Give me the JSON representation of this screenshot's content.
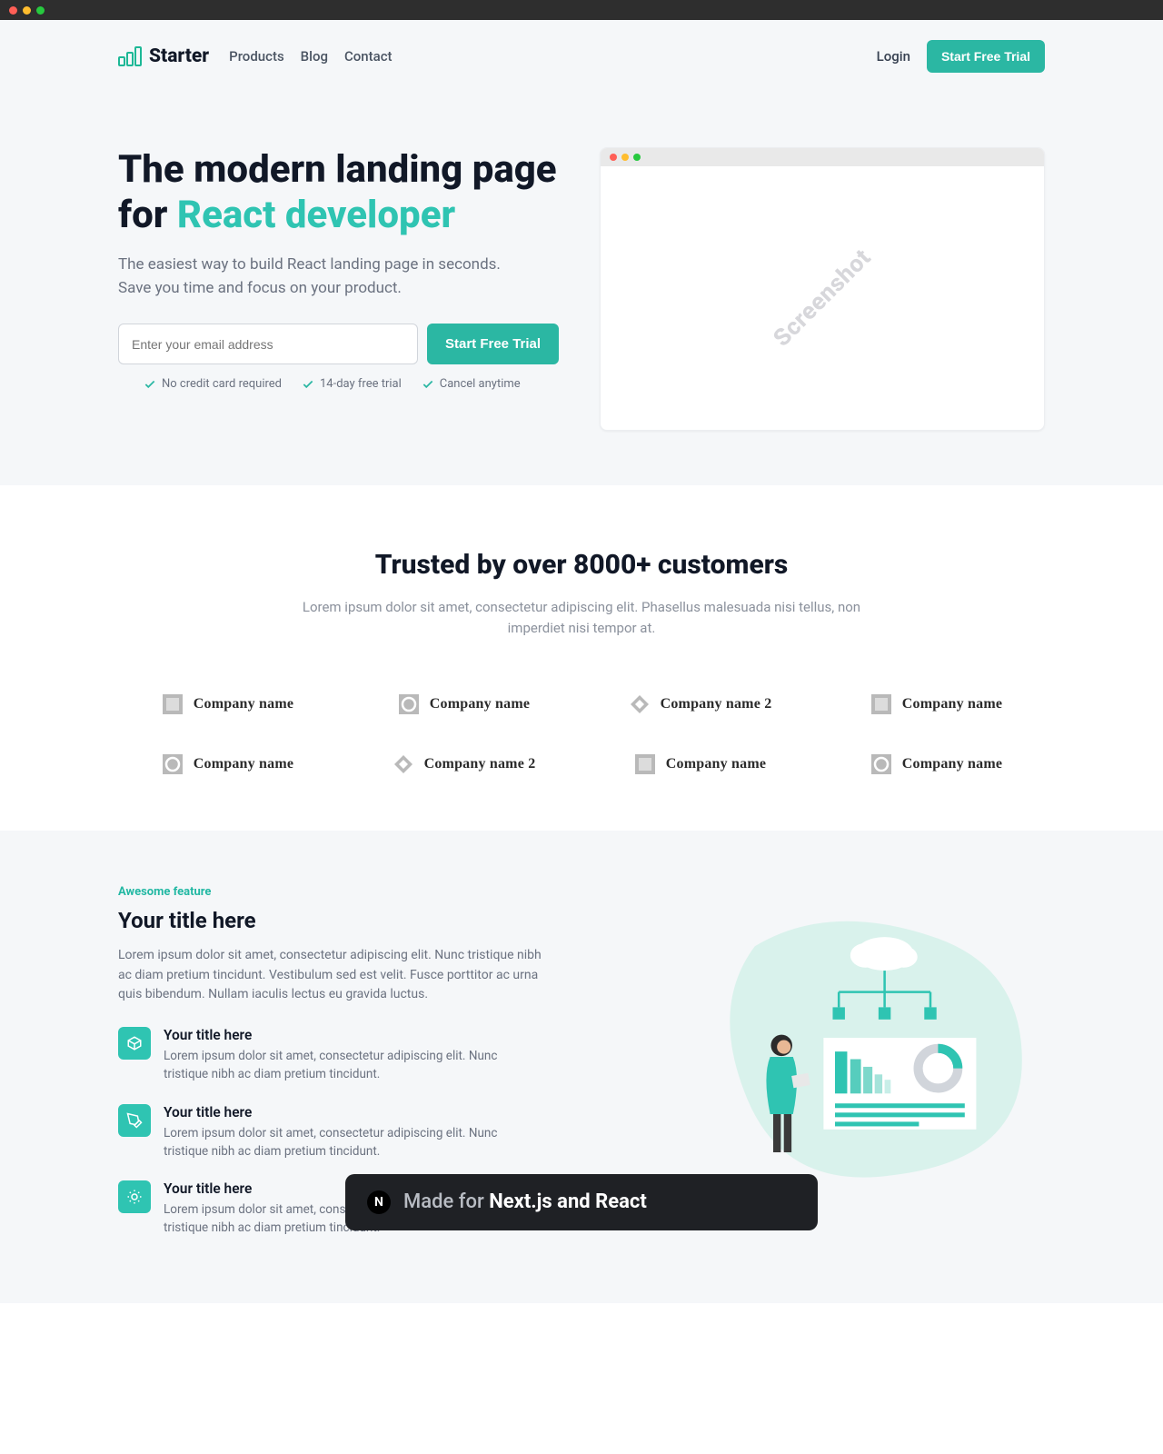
{
  "nav": {
    "brand": "Starter",
    "links": [
      "Products",
      "Blog",
      "Contact"
    ],
    "login": "Login",
    "cta": "Start Free Trial"
  },
  "hero": {
    "title_pre": "The modern landing page for ",
    "title_highlight": "React developer",
    "description": "The easiest way to build React landing page in seconds. Save you time and focus on your product.",
    "email_placeholder": "Enter your email address",
    "submit": "Start Free Trial",
    "benefits": [
      "No credit card required",
      "14-day free trial",
      "Cancel anytime"
    ],
    "screenshot_label": "Screenshot"
  },
  "trusted": {
    "heading": "Trusted by over 8000+ customers",
    "sub": "Lorem ipsum dolor sit amet, consectetur adipiscing elit. Phasellus malesuada nisi tellus, non imperdiet nisi tempor at.",
    "logos": [
      {
        "name": "Company name",
        "shape": "square"
      },
      {
        "name": "Company name",
        "shape": "circle"
      },
      {
        "name": "Company name 2",
        "shape": "diamond"
      },
      {
        "name": "Company name",
        "shape": "square"
      },
      {
        "name": "Company name",
        "shape": "circle"
      },
      {
        "name": "Company name 2",
        "shape": "diamond"
      },
      {
        "name": "Company name",
        "shape": "square"
      },
      {
        "name": "Company name",
        "shape": "circle"
      }
    ]
  },
  "features": {
    "eyebrow": "Awesome feature",
    "title": "Your title here",
    "desc": "Lorem ipsum dolor sit amet, consectetur adipiscing elit. Nunc tristique nibh ac diam pretium tincidunt. Vestibulum sed est velit. Fusce porttitor ac urna quis bibendum. Nullam iaculis lectus eu gravida luctus.",
    "items": [
      {
        "title": "Your title here",
        "desc": "Lorem ipsum dolor sit amet, consectetur adipiscing elit. Nunc tristique nibh ac diam pretium tincidunt."
      },
      {
        "title": "Your title here",
        "desc": "Lorem ipsum dolor sit amet, consectetur adipiscing elit. Nunc tristique nibh ac diam pretium tincidunt."
      },
      {
        "title": "Your title here",
        "desc": "Lorem ipsum dolor sit amet, consectetur adipiscing elit. Nunc tristique nibh ac diam pretium tincidunt."
      }
    ]
  },
  "toast": {
    "pre": "Made for ",
    "strong": "Next.js and React",
    "icon": "N"
  }
}
